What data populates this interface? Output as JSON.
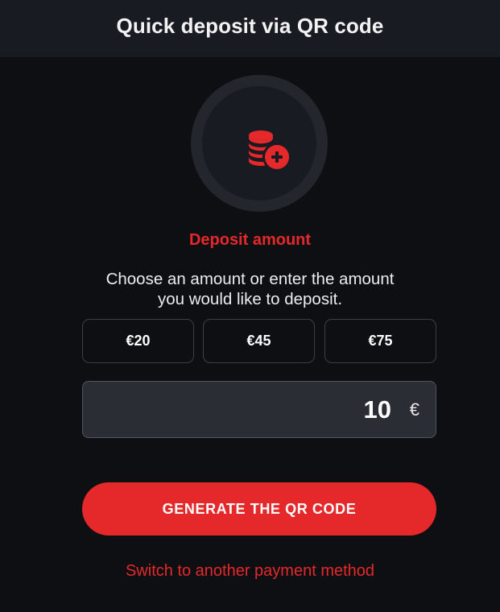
{
  "header": {
    "title": "Quick deposit via QR code"
  },
  "icon": {
    "name": "coins-plus-icon",
    "color": "#e5282a"
  },
  "section": {
    "label": "Deposit amount",
    "instructions_line1": "Choose an amount or enter the amount",
    "instructions_line2": "you would like to deposit."
  },
  "amounts": [
    {
      "label": "€20"
    },
    {
      "label": "€45"
    },
    {
      "label": "€75"
    }
  ],
  "amount_field": {
    "value": "10",
    "currency": "€"
  },
  "actions": {
    "generate_label": "GENERATE THE QR CODE",
    "switch_label": "Switch to another payment method"
  },
  "colors": {
    "accent": "#e5282a",
    "background": "#0d0f13",
    "header_bg": "#181b22"
  }
}
